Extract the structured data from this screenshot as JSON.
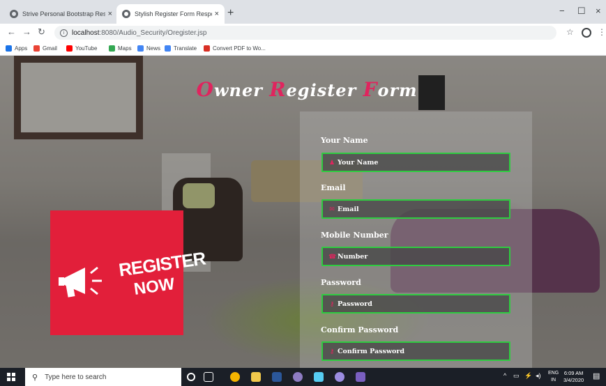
{
  "browser": {
    "tabs": [
      {
        "title": "Strive Personal Bootstrap Respon",
        "active": false
      },
      {
        "title": "Stylish Register Form Responsive",
        "active": true
      }
    ],
    "new_tab": "+",
    "close_glyph": "×",
    "url_host": "localhost",
    "url_path": ":8080/Audio_Security/Oregister.jsp",
    "window_controls": {
      "minimize": "−",
      "maximize": "☐",
      "close": "×"
    },
    "bookmarks": [
      {
        "label": "Apps",
        "icon": "apps-grid-icon",
        "color": "#1a73e8"
      },
      {
        "label": "Gmail",
        "icon": "gmail-icon",
        "color": "#ea4335"
      },
      {
        "label": "YouTube",
        "icon": "youtube-icon",
        "color": "#ff0000"
      },
      {
        "label": "Maps",
        "icon": "maps-icon",
        "color": "#34a853"
      },
      {
        "label": "News",
        "icon": "news-icon",
        "color": "#4285f4"
      },
      {
        "label": "Translate",
        "icon": "translate-icon",
        "color": "#4285f4"
      },
      {
        "label": "Convert PDF to Wo...",
        "icon": "pdf-icon",
        "color": "#d93025"
      }
    ]
  },
  "page": {
    "title_parts": [
      {
        "cap": "O",
        "rest": "wner "
      },
      {
        "cap": "R",
        "rest": "egister "
      },
      {
        "cap": "F",
        "rest": "orm"
      }
    ],
    "promo": {
      "line1": "REGISTER",
      "line2": "NOW"
    },
    "fields": [
      {
        "label": "Your Name",
        "placeholder": "Your Name",
        "icon": "user-icon"
      },
      {
        "label": "Email",
        "placeholder": "Email",
        "icon": "envelope-icon"
      },
      {
        "label": "Mobile Number",
        "placeholder": "Number",
        "icon": "phone-icon"
      },
      {
        "label": "Password",
        "placeholder": "Password",
        "icon": "key-icon"
      },
      {
        "label": "Confirm Password",
        "placeholder": "Confirm Password",
        "icon": "key-icon"
      }
    ],
    "accent_color": "#e0245e",
    "field_border_color": "#2ecc40"
  },
  "taskbar": {
    "search_placeholder": "Type here to search",
    "language": "ENG",
    "region": "IN",
    "time": "6:09 AM",
    "date": "3/4/2020"
  }
}
